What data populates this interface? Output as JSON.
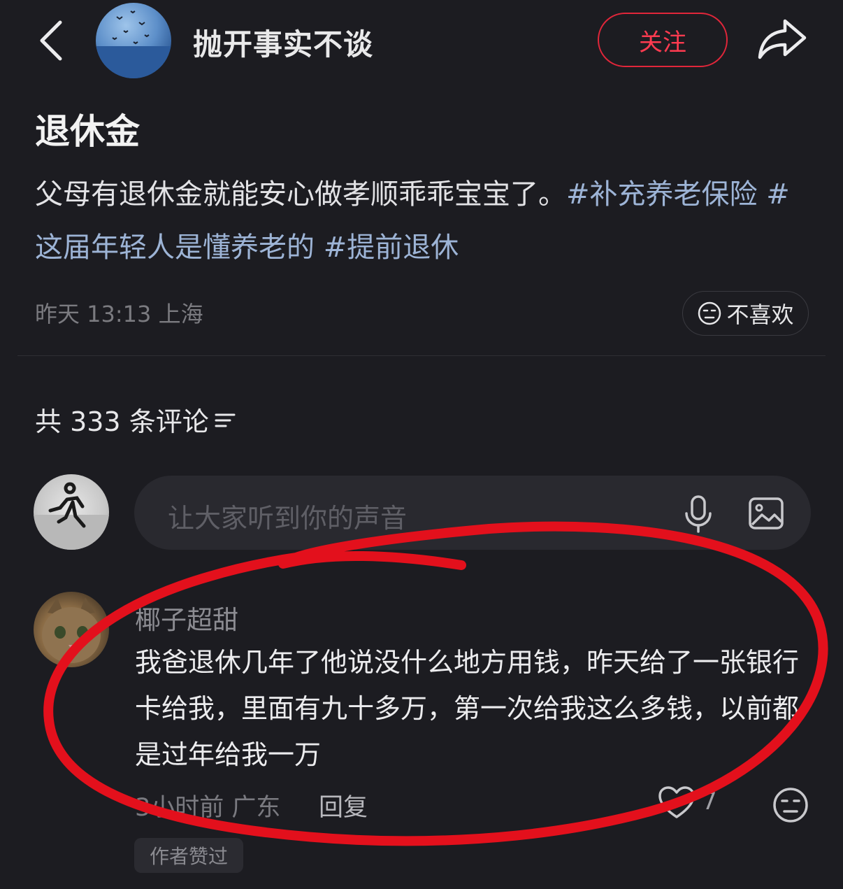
{
  "header": {
    "author_name": "抛开事实不谈",
    "follow_label": "关注"
  },
  "post": {
    "title": "退休金",
    "body": "父母有退休金就能安心做孝顺乖乖宝宝了。",
    "tags": [
      "#补充养老保险",
      "#这届年轻人是懂养老的",
      "#提前退休"
    ],
    "meta": "昨天 13:13 上海",
    "dislike_label": "不喜欢"
  },
  "comments_header": {
    "count_label": "共 333 条评论"
  },
  "input": {
    "placeholder": "让大家听到你的声音"
  },
  "comment": {
    "user": "椰子超甜",
    "text": "我爸退休几年了他说没什么地方用钱，昨天给了一张银行卡给我，里面有九十多万，第一次给我这么多钱，以前都是过年给我一万",
    "time_location": "3小时前 广东",
    "reply_label": "回复",
    "like_count": "7",
    "author_liked": "作者赞过"
  },
  "colors": {
    "background": "#1c1c21",
    "accent_red": "#e1263a",
    "tag_blue": "#9db4d6",
    "annotation_red": "#e3101c"
  }
}
